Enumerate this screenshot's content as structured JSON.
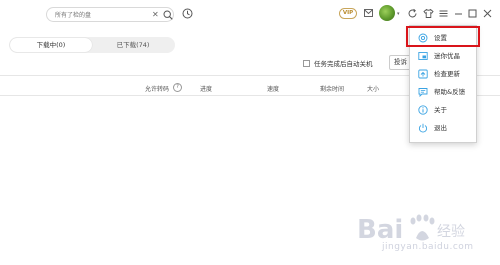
{
  "topbar": {
    "search_placeholder": "所有了检的盘",
    "clear_glyph": "✕",
    "vip_label": "VIP",
    "avatar_caret": "▾"
  },
  "tabs": [
    {
      "label": "下载中(0)"
    },
    {
      "label": "已下载(74)"
    }
  ],
  "toolbar": {
    "auto_shutdown_label": "任务完成后自动关机",
    "settings_button_label": "投诉"
  },
  "columns": {
    "allow_transcode": "允许转码",
    "help_glyph": "?",
    "progress": "进度",
    "speed": "速度",
    "remaining_time": "剩余时间",
    "size": "大小"
  },
  "menu": {
    "items": [
      {
        "label": "设置",
        "icon": "gear-icon"
      },
      {
        "label": "迷你优晶",
        "icon": "mini-mode-icon"
      },
      {
        "label": "检查更新",
        "icon": "update-icon"
      },
      {
        "label": "帮助&反馈",
        "icon": "feedback-icon"
      },
      {
        "label": "关于",
        "icon": "info-icon"
      },
      {
        "label": "退出",
        "icon": "power-icon"
      }
    ]
  },
  "watermark": {
    "brand": "Bai",
    "brand_suffix": "经验",
    "url": "jingyan.baidu.com"
  },
  "colors": {
    "highlight": "#d9141a",
    "menu_icon": "#3aa3e3",
    "vip_gold": "#b8892a"
  }
}
